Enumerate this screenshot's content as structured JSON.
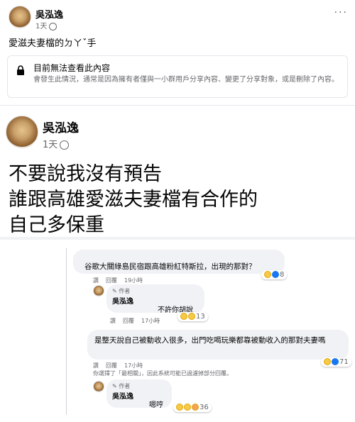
{
  "post1": {
    "author": "吳泓逸",
    "time": "1天",
    "text": "愛滋夫妻檔的ㄉㄚˇ手",
    "unavailable_title": "目前無法查看此內容",
    "unavailable_body": "會發生此情況，通常是因為擁有者僅與一小群用戶分享內容、變更了分享對象，或是刪除了內容。"
  },
  "post2": {
    "author": "吳泓逸",
    "time": "1天",
    "lines": [
      "不要說我沒有預告",
      "誰跟高雄愛滋夫妻檔有合作的",
      "自己多保重"
    ]
  },
  "comments": {
    "c1": {
      "text": "谷歌大關綠島民宿跟高雄粉紅特斯拉，出現的那對？",
      "count": "8",
      "like": "讚",
      "reply": "回覆",
      "time": "19小時"
    },
    "r1": {
      "badge": "作者",
      "author": "吳泓逸",
      "text": "不許你胡說",
      "count": "13",
      "like": "讚",
      "reply": "回覆",
      "time": "17小時"
    },
    "c2": {
      "text": "是整天說自己被動收入很多，出門吃喝玩樂都靠被動收入的那對夫妻嗎",
      "count": "71",
      "like": "讚",
      "reply": "回覆",
      "time": "17小時"
    },
    "notice": "你選擇了「最相關」，因此系統可能已過濾掉部分回覆。",
    "r2": {
      "badge": "作者",
      "author": "吳泓逸",
      "text": "嗯哼",
      "count": "36"
    }
  }
}
